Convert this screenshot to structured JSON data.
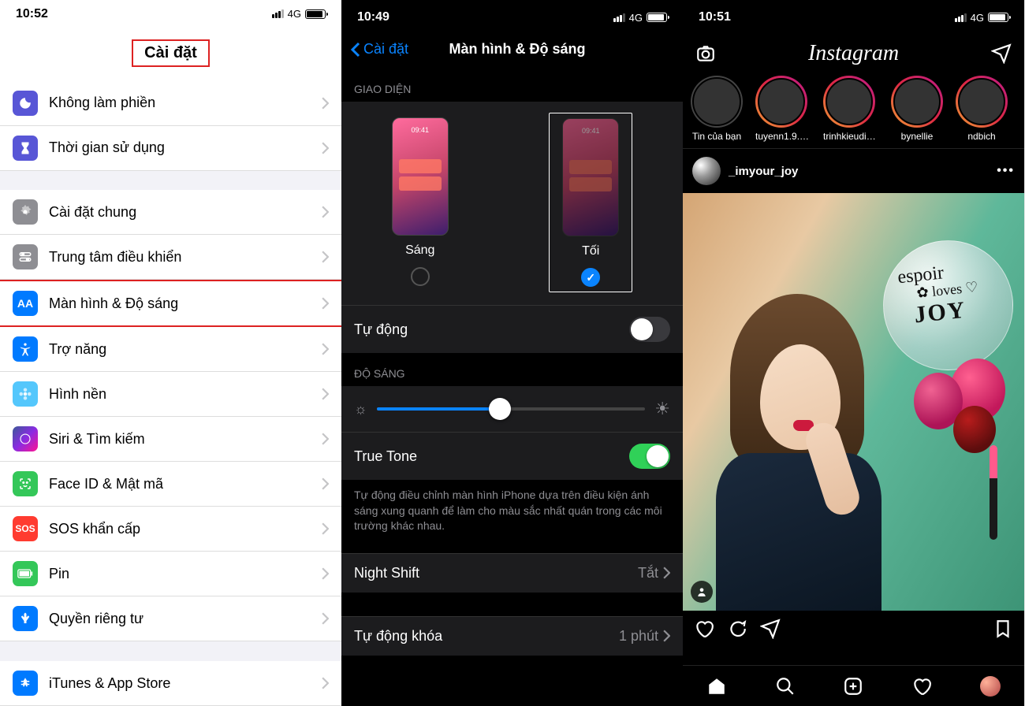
{
  "screen1": {
    "time": "10:52",
    "signal": "4G",
    "title": "Cài đặt",
    "group1": [
      {
        "label": "Không làm phiền",
        "icon": "moon"
      },
      {
        "label": "Thời gian sử dụng",
        "icon": "time"
      }
    ],
    "group2": [
      {
        "label": "Cài đặt chung",
        "icon": "gear"
      },
      {
        "label": "Trung tâm điều khiển",
        "icon": "cc"
      },
      {
        "label": "Màn hình & Độ sáng",
        "icon": "aa",
        "highlight": true
      },
      {
        "label": "Trợ năng",
        "icon": "acc"
      },
      {
        "label": "Hình nền",
        "icon": "wall"
      },
      {
        "label": "Siri & Tìm kiếm",
        "icon": "siri"
      },
      {
        "label": "Face ID & Mật mã",
        "icon": "face"
      },
      {
        "label": "SOS khẩn cấp",
        "icon": "sos"
      },
      {
        "label": "Pin",
        "icon": "pin"
      },
      {
        "label": "Quyền riêng tư",
        "icon": "priv"
      }
    ],
    "group3": [
      {
        "label": "iTunes & App Store",
        "icon": "app"
      }
    ]
  },
  "screen2": {
    "time": "10:49",
    "signal": "4G",
    "back": "Cài đặt",
    "title": "Màn hình & Độ sáng",
    "sec_appearance": "GIAO DIỆN",
    "thumb_time": "09:41",
    "light": "Sáng",
    "dark": "Tối",
    "auto": "Tự động",
    "sec_brightness": "ĐỘ SÁNG",
    "true_tone": "True Tone",
    "true_tone_desc": "Tự động điều chỉnh màn hình iPhone dựa trên điều kiện ánh sáng xung quanh để làm cho màu sắc nhất quán trong các môi trường khác nhau.",
    "night_shift": "Night Shift",
    "night_shift_val": "Tắt",
    "auto_lock": "Tự động khóa",
    "auto_lock_val": "1 phút"
  },
  "screen3": {
    "time": "10:51",
    "signal": "4G",
    "logo": "Instagram",
    "stories": [
      {
        "name": "Tin của bạn",
        "self": true
      },
      {
        "name": "tuyenn1.9.7.6"
      },
      {
        "name": "trinhkieudie..."
      },
      {
        "name": "bynellie"
      },
      {
        "name": "ndbich"
      }
    ],
    "post_user": "_imyour_joy",
    "balloon_l1": "espoir",
    "balloon_l2": "loves",
    "balloon_l3": "JOY"
  }
}
